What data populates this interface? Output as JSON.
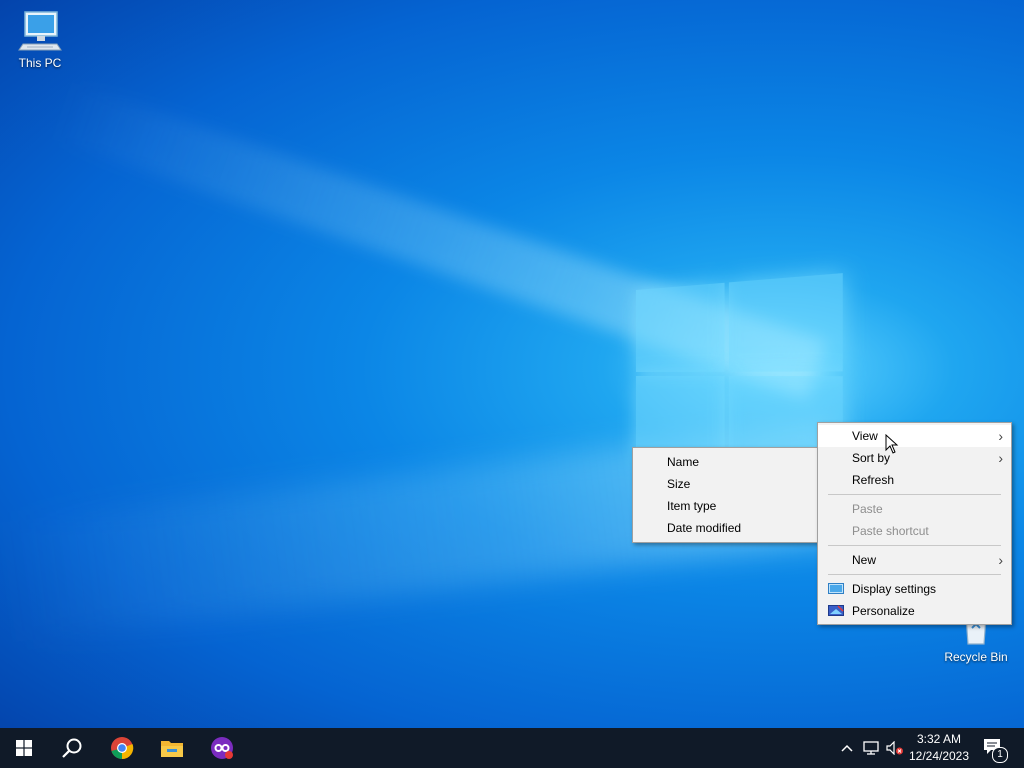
{
  "desktop": {
    "icons": [
      {
        "label": "This PC"
      },
      {
        "label": "Recycle Bin"
      }
    ]
  },
  "context_menu": {
    "items": [
      {
        "label": "View",
        "has_submenu": true,
        "highlighted": true
      },
      {
        "label": "Sort by",
        "has_submenu": true
      },
      {
        "label": "Refresh"
      },
      {
        "label": "Paste",
        "disabled": true
      },
      {
        "label": "Paste shortcut",
        "disabled": true
      },
      {
        "label": "New",
        "has_submenu": true
      },
      {
        "label": "Display settings",
        "icon": "display-icon"
      },
      {
        "label": "Personalize",
        "icon": "personalize-icon"
      }
    ],
    "arrow_glyph": "›"
  },
  "sort_submenu": {
    "items": [
      {
        "label": "Name"
      },
      {
        "label": "Size"
      },
      {
        "label": "Item type"
      },
      {
        "label": "Date modified"
      }
    ]
  },
  "taskbar": {
    "pinned": [
      "start-icon",
      "search-icon",
      "chrome-icon",
      "file-explorer-icon",
      "app-icon"
    ],
    "tray": {
      "icons": [
        "chevron-up-icon",
        "network-icon",
        "volume-muted-icon"
      ],
      "time": "3:32 AM",
      "date": "12/24/2023",
      "notification_count": "1"
    }
  },
  "colors": {
    "taskbar": "#101a28",
    "menu_bg": "#f2f2f2",
    "desktop_accent": "#0b86e6"
  }
}
